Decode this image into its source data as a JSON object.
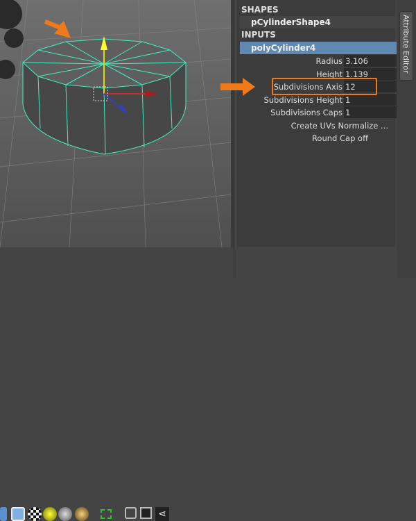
{
  "attribute_editor": {
    "shapes_header": "SHAPES",
    "shape_node": "pCylinderShape4",
    "inputs_header": "INPUTS",
    "input_node": "polyCylinder4",
    "rows": [
      {
        "label": "Radius",
        "value": "3.106"
      },
      {
        "label": "Height",
        "value": "1.139"
      },
      {
        "label": "Subdivisions Axis",
        "value": "12"
      },
      {
        "label": "Subdivisions Height",
        "value": "1"
      },
      {
        "label": "Subdivisions Caps",
        "value": "1"
      }
    ],
    "create_uvs": "Create UVs Normalize ...",
    "round_cap": "Round Cap off",
    "side_tab": "Attribute Editor"
  },
  "colors": {
    "accent": "#f07a1a",
    "selected": "#6088b0",
    "wireframe": "#40f0c0"
  }
}
